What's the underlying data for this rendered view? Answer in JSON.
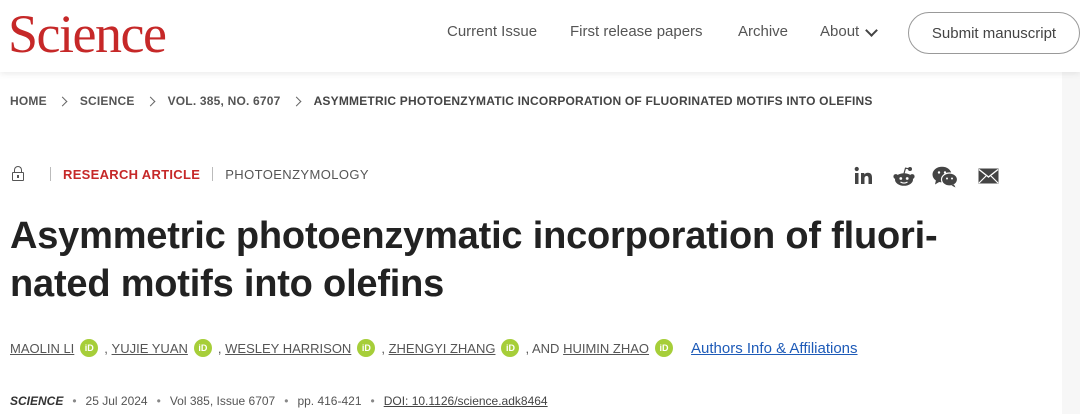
{
  "header": {
    "logo": "Science",
    "nav": {
      "current_issue": "Current Issue",
      "first_release": "First release papers",
      "archive": "Archive",
      "about": "About"
    },
    "submit": "Submit manuscript"
  },
  "breadcrumb": [
    "HOME",
    "SCIENCE",
    "VOL. 385, NO. 6707",
    "ASYMMETRIC PHOTOENZYMATIC INCORPORATION OF FLUORINATED MOTIFS INTO OLEFINS"
  ],
  "article": {
    "type": "RESEARCH ARTICLE",
    "topic": "PHOTOENZYMOLOGY",
    "title_line1": "Asymmetric photoenzymatic incorporation of fluori-",
    "title_line2": "nated motifs into olefins",
    "authors": [
      "MAOLIN LI",
      "YUJIE YUAN",
      "WESLEY HARRISON",
      "ZHENGYI ZHANG",
      "HUIMIN ZHAO"
    ],
    "author_sep": ",",
    "and_text": ", AND",
    "orcid_label": "iD",
    "affiliations_link": "Authors Info & Affiliations"
  },
  "citation": {
    "journal": "SCIENCE",
    "date": "25 Jul 2024",
    "volume": "Vol 385, Issue 6707",
    "pages": "pp. 416-421",
    "doi": "DOI: 10.1126/science.adk8464"
  },
  "share_icons": [
    "linkedin-icon",
    "reddit-icon",
    "wechat-icon",
    "email-icon"
  ],
  "colors": {
    "brand_red": "#c62828",
    "orcid_green": "#a6ce39",
    "link_blue": "#1e5bb8"
  }
}
